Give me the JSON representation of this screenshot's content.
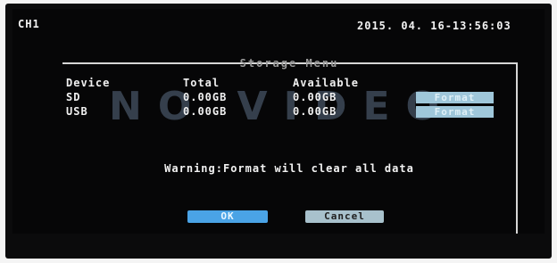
{
  "osd": {
    "channel": "CH1",
    "datetime": "2015. 04. 16-13:56:03"
  },
  "dialog": {
    "title": "Storage Menu",
    "watermark": "NO VIDEO",
    "headers": {
      "device": "Device",
      "total": "Total",
      "available": "Available"
    },
    "rows": [
      {
        "device": "SD",
        "total": "0.00GB",
        "available": "0.00GB",
        "button": "Format"
      },
      {
        "device": "USB",
        "total": "0.00GB",
        "available": "0.00GB",
        "button": "Format"
      }
    ],
    "warning": "Warning:Format will clear all data",
    "ok_label": "OK",
    "cancel_label": "Cancel"
  }
}
